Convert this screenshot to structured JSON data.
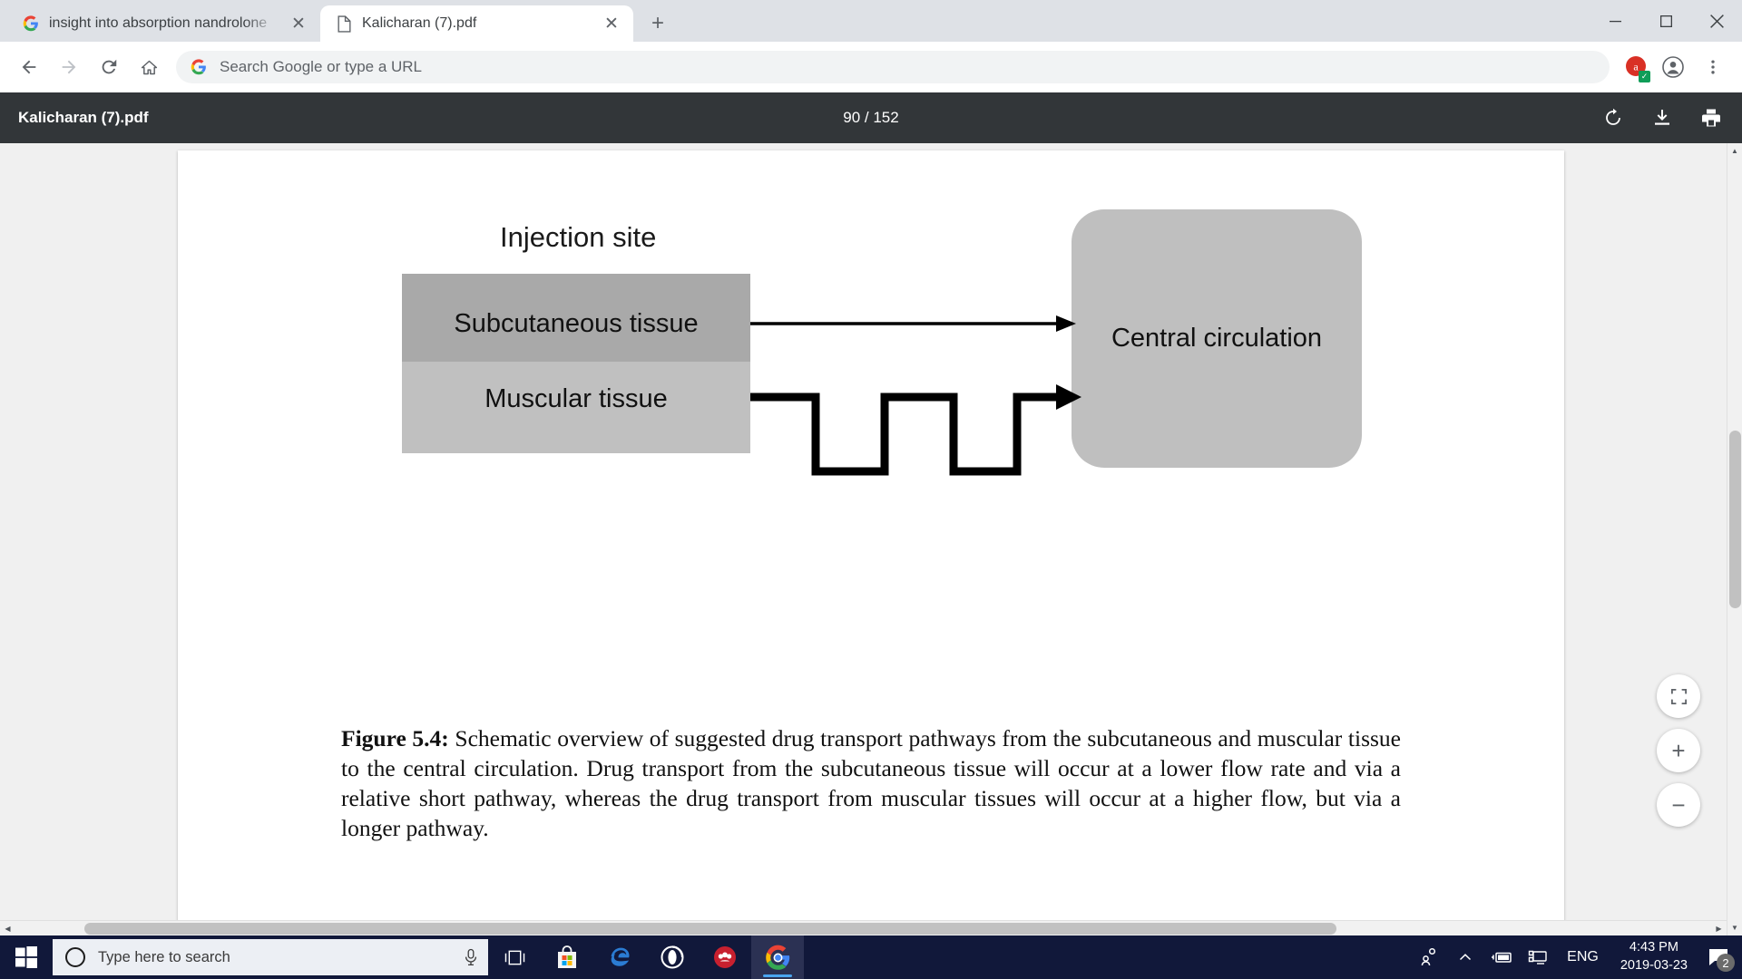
{
  "browser": {
    "tabs": [
      {
        "title": "insight into absorption nandrolone",
        "favicon": "google-icon",
        "active": false,
        "close_label": "✕"
      },
      {
        "title": "Kalicharan (7).pdf",
        "favicon": "pdf-file-icon",
        "active": true,
        "close_label": "✕"
      }
    ],
    "new_tab_label": "+",
    "window_controls": {
      "minimize": "minimize-icon",
      "maximize": "maximize-icon",
      "close": "close-icon"
    },
    "omnibox": {
      "placeholder": "Search Google or type a URL",
      "value": "",
      "search_engine_icon": "google-icon"
    },
    "nav": {
      "back": "back-arrow-icon",
      "forward": "forward-arrow-icon",
      "reload": "reload-icon",
      "home": "home-icon"
    },
    "extension_badge": "✓",
    "profile_icon": "profile-avatar-icon",
    "menu_icon": "three-dot-menu-icon"
  },
  "pdf_viewer": {
    "filename": "Kalicharan (7).pdf",
    "page_current": "90",
    "page_total": "152",
    "page_counter": "90 / 152",
    "actions": [
      {
        "name": "rotate-button",
        "icon": "rotate-clockwise-icon"
      },
      {
        "name": "download-button",
        "icon": "download-icon"
      },
      {
        "name": "print-button",
        "icon": "print-icon"
      }
    ],
    "zoom_controls": [
      {
        "name": "fit-to-page-button",
        "label": "⤡"
      },
      {
        "name": "zoom-in-button",
        "label": "+"
      },
      {
        "name": "zoom-out-button",
        "label": "−"
      }
    ]
  },
  "document": {
    "figure": {
      "injection_site_label": "Injection site",
      "subcutaneous_label": "Subcutaneous tissue",
      "muscular_label": "Muscular tissue",
      "central_label": "Central circulation",
      "colors": {
        "subcutaneous": "#a9a9a9",
        "muscular": "#c0c0c0",
        "central": "#bfbfbf",
        "arrow": "#000000"
      }
    },
    "caption": {
      "number": "Figure 5.4:",
      "text": " Schematic overview of suggested drug transport pathways from the subcutaneous and muscular tissue to the central circulation. Drug transport from the subcutaneous tissue will occur at a lower flow rate and via a relative short pathway, whereas the drug transport from muscular tissues will occur at a higher flow, but via a longer pathway."
    }
  },
  "taskbar": {
    "start_icon": "windows-start-icon",
    "search_placeholder": "Type here to search",
    "cortana_icon": "cortana-circle-icon",
    "mic_icon": "microphone-icon",
    "apps": [
      {
        "name": "task-view-button",
        "icon": "task-view-icon"
      },
      {
        "name": "microsoft-store-button",
        "icon": "microsoft-store-icon"
      },
      {
        "name": "edge-button",
        "icon": "edge-icon"
      },
      {
        "name": "opera-button",
        "icon": "opera-icon"
      },
      {
        "name": "mendeley-button",
        "icon": "mendeley-icon"
      },
      {
        "name": "chrome-button",
        "icon": "chrome-icon"
      }
    ],
    "tray": {
      "people_icon": "people-icon",
      "show_hidden_icon": "chevron-up-icon",
      "battery_icon": "battery-charging-icon",
      "network_icon": "display-network-icon",
      "language": "ENG",
      "time": "4:43 PM",
      "date": "2019-03-23",
      "notification_icon": "notification-icon",
      "notification_count": "2"
    }
  }
}
